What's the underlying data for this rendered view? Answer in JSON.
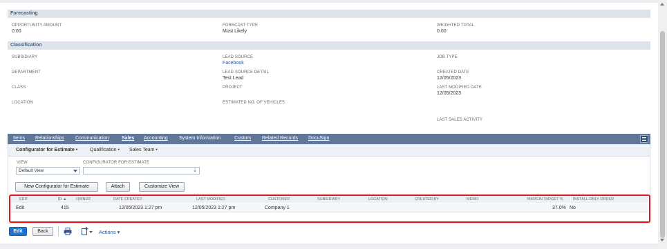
{
  "forecasting": {
    "header": "Forecasting",
    "fields": [
      {
        "label": "OPPORTUNITY AMOUNT",
        "value": "0.00"
      },
      {
        "label": "FORECAST TYPE",
        "value": "Most Likely"
      },
      {
        "label": "WEIGHTED TOTAL",
        "value": "0.00"
      }
    ]
  },
  "classification": {
    "header": "Classification",
    "subsidiary": {
      "label": "SUBSIDIARY",
      "value": ""
    },
    "lead_source": {
      "label": "LEAD SOURCE",
      "value": "Facebook"
    },
    "job_type": {
      "label": "JOB TYPE",
      "value": ""
    },
    "department": {
      "label": "DEPARTMENT",
      "value": ""
    },
    "lead_source_detail": {
      "label": "LEAD SOURCE DETAIL",
      "value": "Test Lead"
    },
    "created_date": {
      "label": "CREATED DATE",
      "value": "12/05/2023"
    },
    "class": {
      "label": "CLASS",
      "value": ""
    },
    "project": {
      "label": "PROJECT",
      "value": ""
    },
    "last_modified_date": {
      "label": "LAST MODIFIED DATE",
      "value": "12/05/2023"
    },
    "location": {
      "label": "LOCATION",
      "value": ""
    },
    "est_vehicles": {
      "label": "ESTIMATED NO. OF VEHICLES",
      "value": ""
    },
    "last_sales_activity": {
      "label": "LAST SALES ACTIVITY",
      "value": ""
    }
  },
  "tabs": [
    {
      "label": "Items"
    },
    {
      "label": "Relationships"
    },
    {
      "label": "Communication"
    },
    {
      "label": "Sales"
    },
    {
      "label": "Accounting"
    },
    {
      "label": "System Information"
    },
    {
      "label": "Custom"
    },
    {
      "label": "Related Records"
    },
    {
      "label": "DocuSign"
    }
  ],
  "subtabs": [
    {
      "label": "Configurator for Estimate •"
    },
    {
      "label": "Qualification •"
    },
    {
      "label": "Sales Team •"
    }
  ],
  "filters": {
    "view_label": "VIEW",
    "view_value": "Default View",
    "configurator_label": "CONFIGURATOR FOR ESTIMATE",
    "configurator_value": ""
  },
  "buttons": {
    "new_configurator": "New Configurator for Estimate",
    "attach": "Attach",
    "customize_view": "Customize View"
  },
  "grid": {
    "headers": [
      "EDIT",
      "ID ▲",
      "OWNER",
      "DATE CREATED",
      "LAST MODIFIED",
      "CUSTOMER",
      "SUBSIDIARY",
      "LOCATION",
      "CREATED BY",
      "MEMO",
      "MARGIN TARGET %",
      "INSTALL ONLY ORDER"
    ],
    "rows": [
      {
        "edit": "Edit",
        "id": "415",
        "owner": "",
        "date_created": "12/05/2023 1:27 pm",
        "last_modified": "12/05/2023 1:27 pm",
        "customer": "Company 1",
        "subsidiary": "",
        "location": "",
        "created_by": "",
        "memo": "",
        "margin": "37.0%",
        "install_only": "No"
      }
    ]
  },
  "footer": {
    "edit": "Edit",
    "back": "Back",
    "actions": "Actions ▾"
  },
  "colors": {
    "tabbar": "#607799",
    "section_header": "#dfe4eb",
    "link": "#255599",
    "primary_button": "#1d74d1",
    "highlight": "#e0141e"
  }
}
